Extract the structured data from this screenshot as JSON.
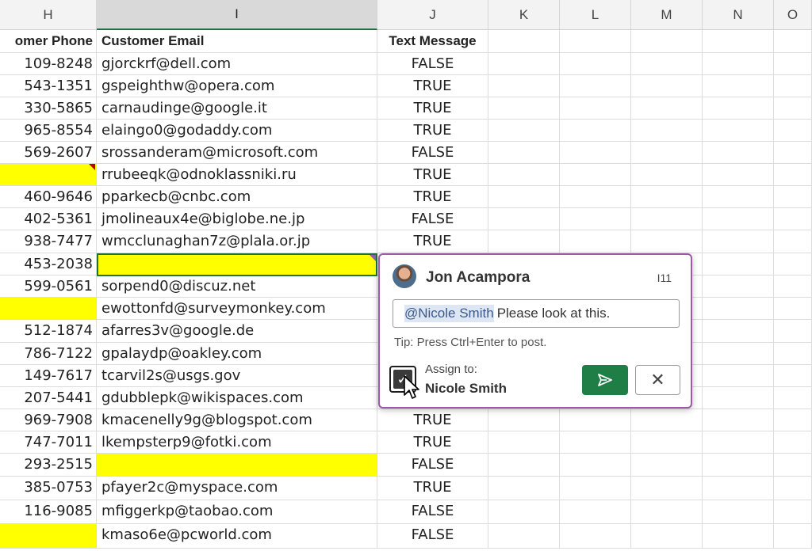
{
  "columns": [
    "H",
    "I",
    "J",
    "K",
    "L",
    "M",
    "N",
    "O"
  ],
  "headers": {
    "h": "omer Phone",
    "i": "Customer Email",
    "j": "Text Message"
  },
  "rows": [
    {
      "phone": "109-8248",
      "email": "gjorckrf@dell.com",
      "text": "FALSE"
    },
    {
      "phone": "543-1351",
      "email": "gspeighthw@opera.com",
      "text": "TRUE"
    },
    {
      "phone": "330-5865",
      "email": "carnaudinge@google.it",
      "text": "TRUE"
    },
    {
      "phone": "965-8554",
      "email": "elaingo0@godaddy.com",
      "text": "TRUE"
    },
    {
      "phone": "569-2607",
      "email": "srossanderam@microsoft.com",
      "text": "FALSE"
    },
    {
      "phone": "",
      "email": "rrubeeqk@odnoklassniki.ru",
      "text": "TRUE",
      "phone_highlight": true,
      "phone_note": true
    },
    {
      "phone": "460-9646",
      "email": "pparkecb@cnbc.com",
      "text": "TRUE"
    },
    {
      "phone": "402-5361",
      "email": "jmolineaux4e@biglobe.ne.jp",
      "text": "FALSE"
    },
    {
      "phone": "938-7477",
      "email": "wmcclunaghan7z@plala.or.jp",
      "text": "TRUE"
    },
    {
      "phone": "453-2038",
      "email": "",
      "text": "",
      "email_highlight": true,
      "email_comment": true
    },
    {
      "phone": "599-0561",
      "email": "sorpend0@discuz.net",
      "text": ""
    },
    {
      "phone": "",
      "email": "ewottonfd@surveymonkey.com",
      "text": "",
      "phone_highlight": true
    },
    {
      "phone": "512-1874",
      "email": "afarres3v@google.de",
      "text": ""
    },
    {
      "phone": "786-7122",
      "email": "gpalaydp@oakley.com",
      "text": ""
    },
    {
      "phone": "149-7617",
      "email": "tcarvil2s@usgs.gov",
      "text": ""
    },
    {
      "phone": "207-5441",
      "email": "gdubblepk@wikispaces.com",
      "text": ""
    },
    {
      "phone": "969-7908",
      "email": "kmacenelly9g@blogspot.com",
      "text": "TRUE"
    },
    {
      "phone": "747-7011",
      "email": "lkempsterp9@fotki.com",
      "text": "TRUE"
    },
    {
      "phone": "293-2515",
      "email": "",
      "text": "FALSE",
      "email_highlight": true
    },
    {
      "phone": "385-0753",
      "email": "pfayer2c@myspace.com",
      "text": "TRUE"
    },
    {
      "phone": "116-9085",
      "email": "mfiggerkp@taobao.com",
      "text": "FALSE"
    },
    {
      "phone": "",
      "email": "kmaso6e@pcworld.com",
      "text": "FALSE",
      "phone_highlight": true
    }
  ],
  "comment": {
    "author": "Jon Acampora",
    "cell_ref": "I11",
    "mention": "@Nicole Smith",
    "message": "Please look at this.",
    "tip": "Tip: Press Ctrl+Enter to post.",
    "assign_label": "Assign to:",
    "assign_name": "Nicole Smith",
    "assign_checked": true,
    "post_icon": "send-icon",
    "cancel_icon": "close-icon",
    "cancel_glyph": "✕",
    "check_glyph": "✓"
  },
  "colors": {
    "highlight": "#ffff00",
    "accent": "#1e7145",
    "comment_border": "#9c5aa8"
  }
}
